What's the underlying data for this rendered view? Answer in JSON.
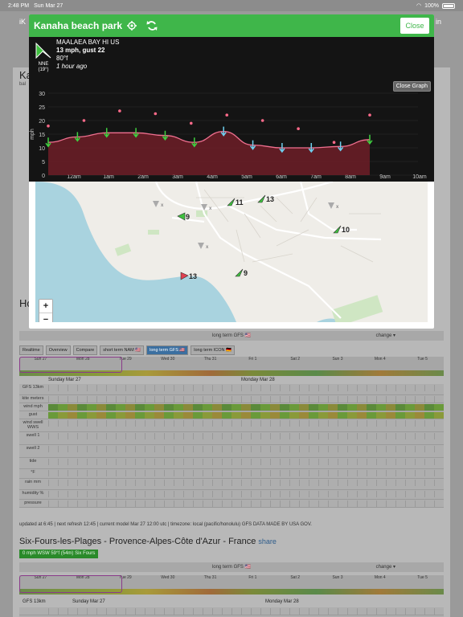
{
  "status": {
    "time": "2:48 PM",
    "date": "Sun Mar 27",
    "battery": "100%"
  },
  "background": {
    "top_title_left": "iK",
    "top_title_right": "in",
    "heading1": "Ka",
    "heading2": "Ho",
    "sub1": "bal",
    "long_term_label": "long term GFS 🇺🇸",
    "change_label": "change ▾",
    "tabs": [
      "Realtime",
      "Overview",
      "Compare",
      "short term NAM 🇺🇸",
      "long term GFS 🇺🇸",
      "long term ICON 🇩🇪"
    ],
    "active_tab_index": 4,
    "calendar_days": [
      "Sun 27",
      "Mon 28",
      "Tue 29",
      "Wed 30",
      "Thu 31",
      "Fri 1",
      "Sat 2",
      "Sun 3",
      "Mon 4",
      "Tue 5"
    ],
    "model_label": "GFS 13km",
    "day_header_1": "Sunday Mar 27",
    "day_header_2": "Monday Mar 28",
    "row_labels": [
      "kite meters",
      "wind mph",
      "gust",
      "wind swell WWS",
      "swell 1",
      "swell 2",
      "tide",
      "°F",
      "rain mm",
      "humidity %",
      "pressure"
    ],
    "footer": "updated at 6:45 | next refresh 12:45 | current model Mar 27 12:00 utc | timezone: local (pacific/honolulu) GFS DATA MADE BY USA GOV.",
    "location2": "Six-Fours-les-Plages - Provence-Alpes-Côte d'Azur - France",
    "share": "share",
    "location2_wind": "0 mph WSW 59°f (54m)",
    "location2_sub": "Six Fours",
    "day_header_3": "Sunday Mar 27",
    "day_header_4": "Monday Mar 28"
  },
  "modal": {
    "title": "Kanaha beach park",
    "close_label": "Close",
    "station": {
      "name": "MAALAEA BAY HI US",
      "wind": "13 mph, gust 22",
      "temp": "80°f",
      "ago": "1 hour ago",
      "dir": "NNE",
      "deg": "(19°)"
    },
    "close_graph_label": "Close Graph",
    "zoom_in": "+",
    "zoom_out": "−",
    "markers": [
      {
        "label": "11",
        "color": "#3fc03f"
      },
      {
        "label": "13",
        "color": "#3fc03f"
      },
      {
        "label": "9",
        "color": "#3fc03f"
      },
      {
        "label": "10",
        "color": "#3fc03f"
      },
      {
        "label": "13",
        "color": "#e04050"
      },
      {
        "label": "9",
        "color": "#3fc03f"
      }
    ]
  },
  "chart_data": {
    "type": "line",
    "ylabel": "mph",
    "ylim": [
      0,
      30
    ],
    "yticks": [
      0,
      5,
      10,
      15,
      20,
      25,
      30
    ],
    "categories": [
      "12am",
      "1am",
      "2am",
      "3am",
      "4am",
      "5am",
      "6am",
      "7am",
      "8am",
      "9am",
      "10am"
    ],
    "series": [
      {
        "values": [
          12,
          14,
          15.5,
          15.5,
          14.5,
          12,
          16,
          11,
          10,
          10,
          10.5,
          13
        ]
      },
      {
        "values": [
          18,
          20,
          23.5,
          22.5,
          19,
          22,
          20,
          17,
          12,
          22
        ]
      }
    ]
  }
}
